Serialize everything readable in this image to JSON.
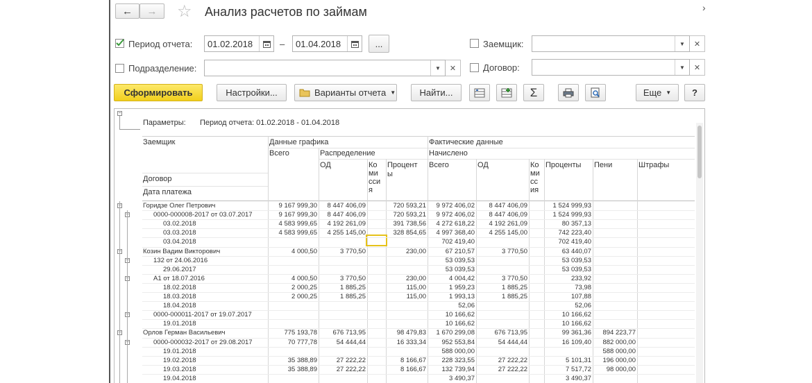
{
  "window": {
    "title": "Анализ расчетов по займам",
    "more_arrow": "›"
  },
  "nav": {
    "back": "←",
    "forward": "→",
    "star": "☆"
  },
  "filters": {
    "period_label": "Период отчета:",
    "period_checked": true,
    "date_from": "01.02.2018",
    "date_to": "01.04.2018",
    "dash": "–",
    "ellipsis": "...",
    "division_label": "Подразделение:",
    "division_value": "",
    "borrower_label": "Заемщик:",
    "borrower_value": "",
    "contract_label": "Договор:",
    "contract_value": ""
  },
  "toolbar": {
    "generate": "Сформировать",
    "settings": "Настройки...",
    "variants": "Варианты отчета",
    "find": "Найти...",
    "sum": "Σ",
    "more": "Еще",
    "help": "?"
  },
  "report": {
    "params_label": "Параметры:",
    "params_value": "Период отчета: 01.02.2018 - 01.04.2018",
    "h_borrower": "Заемщик",
    "h_contract": "Договор",
    "h_paydate": "Дата платежа",
    "h_schedule": "Данные графика",
    "h_total": "Всего",
    "h_distribution": "Распределение",
    "h_od": "ОД",
    "h_commission": "Ко\nми\nсси\nя",
    "h_interest": "Процент\nы",
    "h_actual": "Фактические данные",
    "h_accrued": "Начислено",
    "h_total2": "Всего",
    "h_od2": "ОД",
    "h_commission2": "Ко\nми\nсс\nия",
    "h_interest2": "Проценты",
    "h_penalty": "Пени",
    "h_fines": "Штрафы",
    "rows": [
      {
        "label": "Горидзе Олег Петрович",
        "indent": 0,
        "c1": "9 167 999,30",
        "c2": "8 447 406,09",
        "c3": "",
        "c4": "720 593,21",
        "c5": "9 972 406,02",
        "c6": "8 447 406,09",
        "c7": "",
        "c8": "1 524 999,93",
        "c9": "",
        "c10": ""
      },
      {
        "label": "0000-000008-2017 от 03.07.2017",
        "indent": 1,
        "c1": "9 167 999,30",
        "c2": "8 447 406,09",
        "c3": "",
        "c4": "720 593,21",
        "c5": "9 972 406,02",
        "c6": "8 447 406,09",
        "c7": "",
        "c8": "1 524 999,93",
        "c9": "",
        "c10": ""
      },
      {
        "label": "03.02.2018",
        "indent": 2,
        "c1": "4 583 999,65",
        "c2": "4 192 261,09",
        "c3": "",
        "c4": "391 738,56",
        "c5": "4 272 618,22",
        "c6": "4 192 261,09",
        "c7": "",
        "c8": "80 357,13",
        "c9": "",
        "c10": ""
      },
      {
        "label": "03.03.2018",
        "indent": 2,
        "c1": "4 583 999,65",
        "c2": "4 255 145,00",
        "c3": "",
        "c4": "328 854,65",
        "c5": "4 997 368,40",
        "c6": "4 255 145,00",
        "c7": "",
        "c8": "742 223,40",
        "c9": "",
        "c10": ""
      },
      {
        "label": "03.04.2018",
        "indent": 2,
        "c1": "",
        "c2": "",
        "c3": "",
        "c4": "",
        "c5": "702 419,40",
        "c6": "",
        "c7": "",
        "c8": "702 419,40",
        "c9": "",
        "c10": ""
      },
      {
        "label": "Козин Вадим Викторович",
        "indent": 0,
        "c1": "4 000,50",
        "c2": "3 770,50",
        "c3": "",
        "c4": "230,00",
        "c5": "67 210,57",
        "c6": "3 770,50",
        "c7": "",
        "c8": "63 440,07",
        "c9": "",
        "c10": ""
      },
      {
        "label": "132 от 24.06.2016",
        "indent": 1,
        "c1": "",
        "c2": "",
        "c3": "",
        "c4": "",
        "c5": "53 039,53",
        "c6": "",
        "c7": "",
        "c8": "53 039,53",
        "c9": "",
        "c10": ""
      },
      {
        "label": "29.06.2017",
        "indent": 2,
        "c1": "",
        "c2": "",
        "c3": "",
        "c4": "",
        "c5": "53 039,53",
        "c6": "",
        "c7": "",
        "c8": "53 039,53",
        "c9": "",
        "c10": ""
      },
      {
        "label": "А1 от 18.07.2016",
        "indent": 1,
        "c1": "4 000,50",
        "c2": "3 770,50",
        "c3": "",
        "c4": "230,00",
        "c5": "4 004,42",
        "c6": "3 770,50",
        "c7": "",
        "c8": "233,92",
        "c9": "",
        "c10": ""
      },
      {
        "label": "18.02.2018",
        "indent": 2,
        "c1": "2 000,25",
        "c2": "1 885,25",
        "c3": "",
        "c4": "115,00",
        "c5": "1 959,23",
        "c6": "1 885,25",
        "c7": "",
        "c8": "73,98",
        "c9": "",
        "c10": ""
      },
      {
        "label": "18.03.2018",
        "indent": 2,
        "c1": "2 000,25",
        "c2": "1 885,25",
        "c3": "",
        "c4": "115,00",
        "c5": "1 993,13",
        "c6": "1 885,25",
        "c7": "",
        "c8": "107,88",
        "c9": "",
        "c10": ""
      },
      {
        "label": "18.04.2018",
        "indent": 2,
        "c1": "",
        "c2": "",
        "c3": "",
        "c4": "",
        "c5": "52,06",
        "c6": "",
        "c7": "",
        "c8": "52,06",
        "c9": "",
        "c10": ""
      },
      {
        "label": "0000-000011-2017 от 19.07.2017",
        "indent": 1,
        "c1": "",
        "c2": "",
        "c3": "",
        "c4": "",
        "c5": "10 166,62",
        "c6": "",
        "c7": "",
        "c8": "10 166,62",
        "c9": "",
        "c10": ""
      },
      {
        "label": "19.01.2018",
        "indent": 2,
        "c1": "",
        "c2": "",
        "c3": "",
        "c4": "",
        "c5": "10 166,62",
        "c6": "",
        "c7": "",
        "c8": "10 166,62",
        "c9": "",
        "c10": ""
      },
      {
        "label": "Орлов Герман Васильевич",
        "indent": 0,
        "c1": "775 193,78",
        "c2": "676 713,95",
        "c3": "",
        "c4": "98 479,83",
        "c5": "1 670 299,08",
        "c6": "676 713,95",
        "c7": "",
        "c8": "99 361,36",
        "c9": "894 223,77",
        "c10": ""
      },
      {
        "label": "0000-000032-2017 от 29.08.2017",
        "indent": 1,
        "c1": "70 777,78",
        "c2": "54 444,44",
        "c3": "",
        "c4": "16 333,34",
        "c5": "952 553,84",
        "c6": "54 444,44",
        "c7": "",
        "c8": "16 109,40",
        "c9": "882 000,00",
        "c10": ""
      },
      {
        "label": "19.01.2018",
        "indent": 2,
        "c1": "",
        "c2": "",
        "c3": "",
        "c4": "",
        "c5": "588 000,00",
        "c6": "",
        "c7": "",
        "c8": "",
        "c9": "588 000,00",
        "c10": ""
      },
      {
        "label": "19.02.2018",
        "indent": 2,
        "c1": "35 388,89",
        "c2": "27 222,22",
        "c3": "",
        "c4": "8 166,67",
        "c5": "228 323,55",
        "c6": "27 222,22",
        "c7": "",
        "c8": "5 101,31",
        "c9": "196 000,00",
        "c10": ""
      },
      {
        "label": "19.03.2018",
        "indent": 2,
        "c1": "35 388,89",
        "c2": "27 222,22",
        "c3": "",
        "c4": "8 166,67",
        "c5": "132 739,94",
        "c6": "27 222,22",
        "c7": "",
        "c8": "7 517,72",
        "c9": "98 000,00",
        "c10": ""
      },
      {
        "label": "19.04.2018",
        "indent": 2,
        "c1": "",
        "c2": "",
        "c3": "",
        "c4": "",
        "c5": "3 490,37",
        "c6": "",
        "c7": "",
        "c8": "3 490,37",
        "c9": "",
        "c10": ""
      }
    ]
  }
}
